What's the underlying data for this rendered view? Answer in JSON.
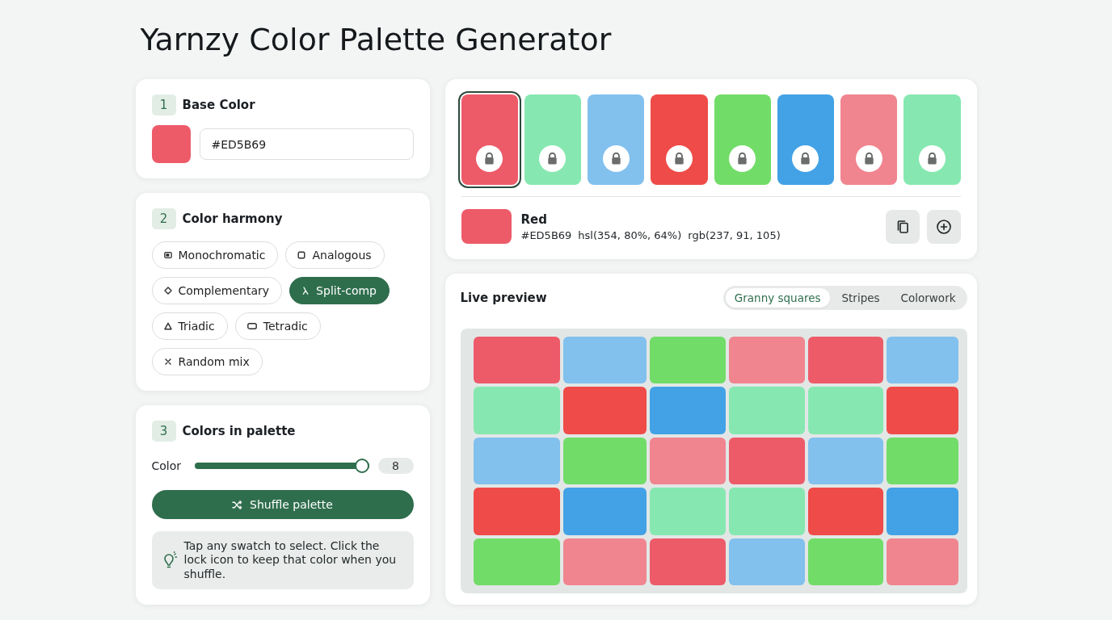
{
  "title": "Yarnzy Color Palette Generator",
  "base_color": {
    "step": "1",
    "heading": "Base Color",
    "color": "#ED5B69",
    "value": "#ED5B69"
  },
  "harmony": {
    "step": "2",
    "heading": "Color harmony",
    "options": [
      {
        "label": "Monochromatic",
        "kind": "monochromatic",
        "selected": false
      },
      {
        "label": "Analogous",
        "kind": "analogous",
        "selected": false
      },
      {
        "label": "Complementary",
        "kind": "complementary",
        "selected": false
      },
      {
        "label": "Split-comp",
        "kind": "split",
        "selected": true
      },
      {
        "label": "Triadic",
        "kind": "triadic",
        "selected": false
      },
      {
        "label": "Tetradic",
        "kind": "tetradic",
        "selected": false
      },
      {
        "label": "Random mix",
        "kind": "random",
        "selected": false
      }
    ]
  },
  "palette_size": {
    "step": "3",
    "heading": "Colors in palette",
    "slider": {
      "label": "Color",
      "level": 1,
      "value": "8"
    },
    "shuffle_button": "Shuffle palette",
    "tip": "Tap any swatch to select. Click the lock icon to keep that color when you shuffle."
  },
  "palette": {
    "swatches": [
      {
        "color": "#ED5B69",
        "selected": true
      },
      {
        "color": "#86E8B0",
        "selected": false
      },
      {
        "color": "#82C0EE",
        "selected": false
      },
      {
        "color": "#EF4B48",
        "selected": false
      },
      {
        "color": "#72DC68",
        "selected": false
      },
      {
        "color": "#43A2E6",
        "selected": false
      },
      {
        "color": "#F0858F",
        "selected": false
      },
      {
        "color": "#86E8B0",
        "selected": false
      }
    ],
    "selected_color": {
      "name": "Red",
      "hex": "#ED5B69",
      "hsl": "hsl(354, 80%, 64%)",
      "rgb": "rgb(237, 91, 105)"
    }
  },
  "preview": {
    "heading": "Live preview",
    "tabs": [
      {
        "label": "Granny squares",
        "selected": true
      },
      {
        "label": "Stripes",
        "selected": false
      },
      {
        "label": "Colorwork",
        "selected": false
      }
    ],
    "squares": [
      {
        "color": "#ED5B69"
      },
      {
        "color": "#82C0EE"
      },
      {
        "color": "#72DC68"
      },
      {
        "color": "#F0858F"
      },
      {
        "color": "#ED5B69"
      },
      {
        "color": "#82C0EE"
      },
      {
        "color": "#86E8B0"
      },
      {
        "color": "#EF4B48"
      },
      {
        "color": "#43A2E6"
      },
      {
        "color": "#86E8B0"
      },
      {
        "color": "#86E8B0"
      },
      {
        "color": "#EF4B48"
      },
      {
        "color": "#82C0EE"
      },
      {
        "color": "#72DC68"
      },
      {
        "color": "#F0858F"
      },
      {
        "color": "#ED5B69"
      },
      {
        "color": "#82C0EE"
      },
      {
        "color": "#72DC68"
      },
      {
        "color": "#EF4B48"
      },
      {
        "color": "#43A2E6"
      },
      {
        "color": "#86E8B0"
      },
      {
        "color": "#86E8B0"
      },
      {
        "color": "#EF4B48"
      },
      {
        "color": "#43A2E6"
      },
      {
        "color": "#72DC68"
      },
      {
        "color": "#F0858F"
      },
      {
        "color": "#ED5B69"
      },
      {
        "color": "#82C0EE"
      },
      {
        "color": "#72DC68"
      },
      {
        "color": "#F0858F"
      }
    ]
  }
}
